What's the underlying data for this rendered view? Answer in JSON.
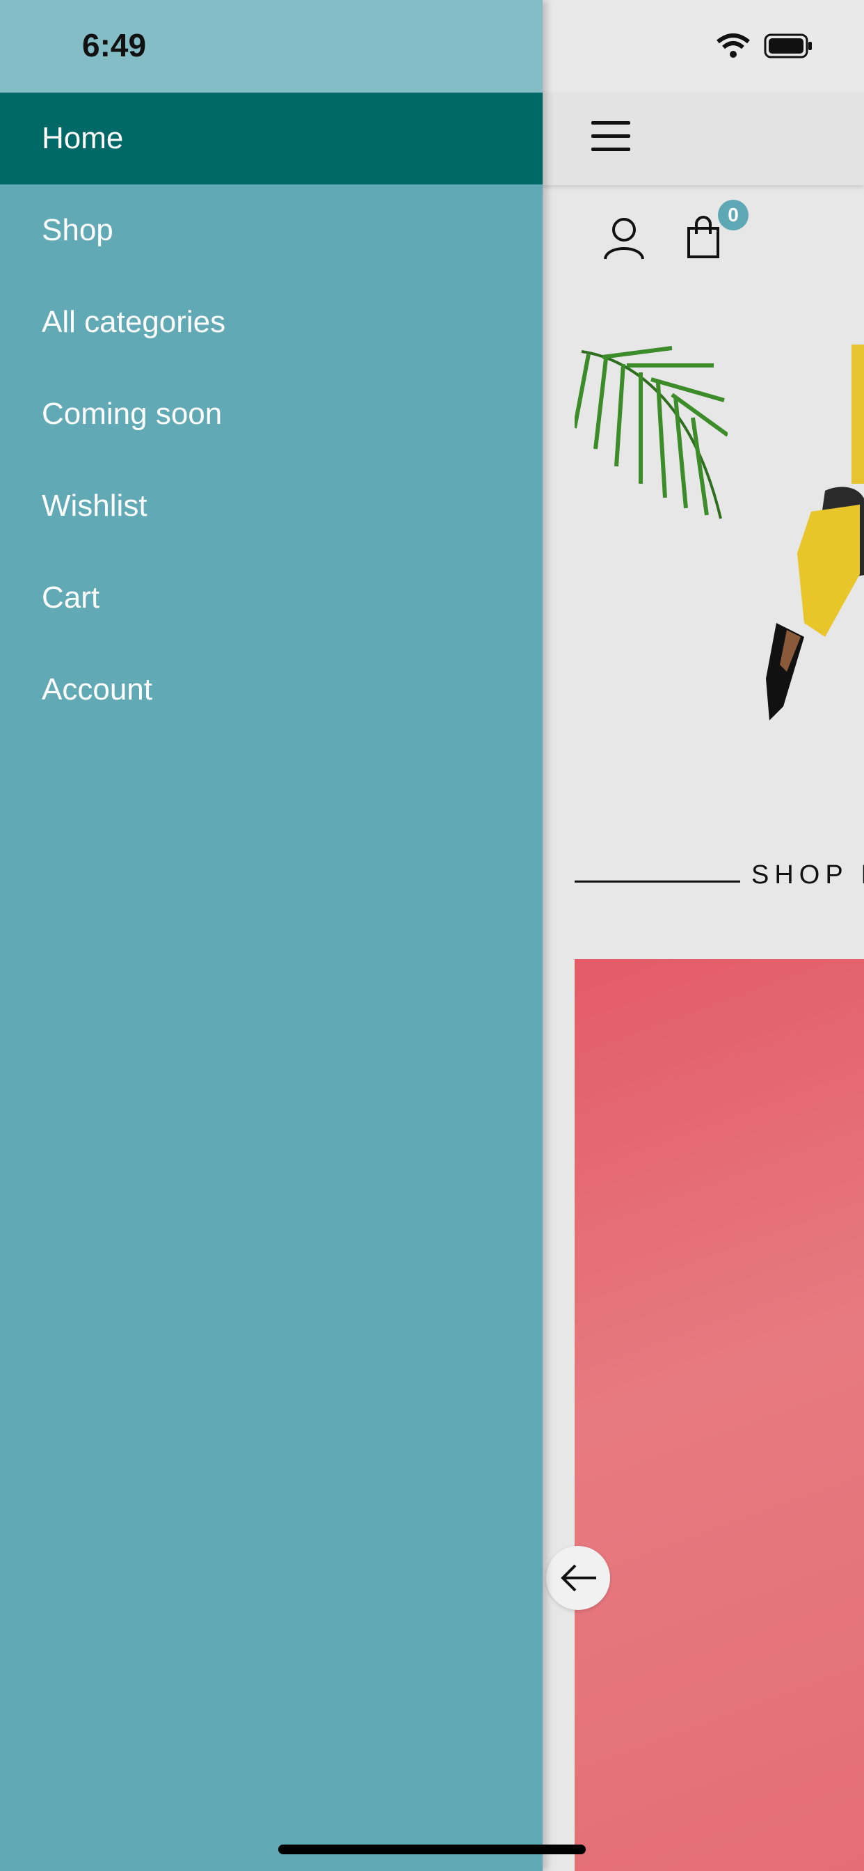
{
  "status_bar": {
    "time": "6:49"
  },
  "drawer": {
    "items": [
      {
        "label": "Home",
        "active": true
      },
      {
        "label": "Shop",
        "active": false
      },
      {
        "label": "All categories",
        "active": false
      },
      {
        "label": "Coming soon",
        "active": false
      },
      {
        "label": "Wishlist",
        "active": false
      },
      {
        "label": "Cart",
        "active": false
      },
      {
        "label": "Account",
        "active": false
      }
    ],
    "background_color": "#61a9b4",
    "active_color": "#006866"
  },
  "header": {
    "menu_icon": "hamburger-icon",
    "account_icon": "user-icon",
    "cart_icon": "shopping-bag-icon",
    "cart_count": "0"
  },
  "content": {
    "section_heading": "SHOP B"
  },
  "back_button_icon": "arrow-left-icon"
}
